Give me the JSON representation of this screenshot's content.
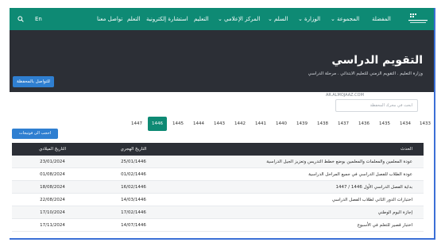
{
  "nav": {
    "items": [
      "المفضلة",
      "المجموعة",
      "الوزارة",
      "السلم",
      "المركز الإعلامي",
      "التعليم",
      "استشارة إلكترونية",
      "التعلم",
      "تواصل معنا"
    ],
    "lang": "En"
  },
  "header": {
    "title": "التقويم الدراسي",
    "breadcrumb": "وزارة التعليم . التقويم الزمني للتعليم الابتدائي . مرحلة الدراسي",
    "share_label": "للتواصل بالمحفظة"
  },
  "search": {
    "placeholder": "ابحث في محرك المحفظة"
  },
  "watermark": "AR.ALMOJAAZ.COM",
  "years": [
    "1447",
    "1446",
    "1445",
    "1444",
    "1443",
    "1442",
    "1441",
    "1440",
    "1439",
    "1438",
    "1437",
    "1436",
    "1435",
    "1434",
    "1433"
  ],
  "active_year": "1446",
  "bulk_label": "احجب الى فوتيجات",
  "table": {
    "headers": {
      "event": "الحدث",
      "hijri": "التاريخ الهجري",
      "greg": "التاريخ الميلادي"
    },
    "rows": [
      {
        "event": "عودة المعلمين والمعلمات والمعلمين بوضع خطط التدريس وتعزيز الجيل الدراسية",
        "hijri": "25/01/1446",
        "greg": "23/01/2024"
      },
      {
        "event": "عودة الطلاب للفصل الدراسي في جميع المراحل الدراسية",
        "hijri": "01/02/1446",
        "greg": "01/08/2024"
      },
      {
        "event": "بداية الفصل الدراسي الأول 1446 / 1447",
        "hijri": "16/02/1446",
        "greg": "18/08/2024"
      },
      {
        "event": "اختبارات الدور الثاني لطلاب الفصل الدراسي",
        "hijri": "14/03/1446",
        "greg": "22/08/2024"
      },
      {
        "event": "إجازة اليوم الوطني",
        "hijri": "17/02/1446",
        "greg": "17/10/2024"
      },
      {
        "event": "اختبار قصير للتعلم في الأسبوع",
        "hijri": "14/07/1446",
        "greg": "17/11/2024"
      }
    ]
  }
}
